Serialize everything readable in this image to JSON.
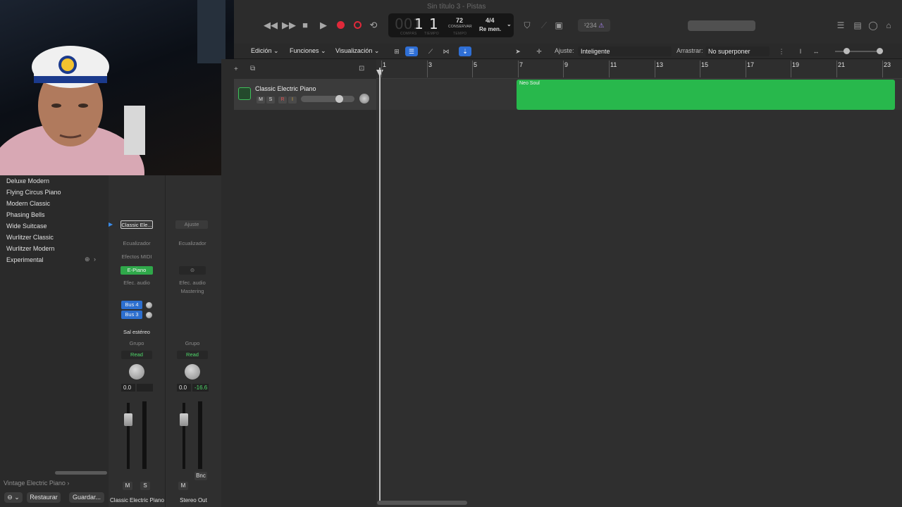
{
  "window": {
    "title": "Sin título 3 - Pistas"
  },
  "transport": {
    "compas": "001",
    "compas_value": "1",
    "tiempo_value": "1",
    "compas_label": "COMPÁS",
    "tiempo_label": "TIEMPO",
    "tempo_value": "72",
    "tempo_mode": "CONSERVAR",
    "tempo_label": "TEMPO",
    "signature": "4/4",
    "key": "Re men.",
    "count_in": "¹234"
  },
  "toolbar": {
    "menus": [
      "Edición",
      "Funciones",
      "Visualización"
    ],
    "ajuste_label": "Ajuste:",
    "ajuste_value": "Inteligente",
    "arrastrar_label": "Arrastrar:",
    "arrastrar_value": "No superponer"
  },
  "library": {
    "items": [
      "Deluxe Modern",
      "Flying Circus Piano",
      "Modern Classic",
      "Phasing Bells",
      "Wide Suitcase",
      "Wurlitzer Classic",
      "Wurlitzer Modern",
      "Experimental"
    ],
    "footer_label": "Vintage Electric Piano",
    "restore_button": "Restaurar",
    "save_button": "Guardar..."
  },
  "strip1": {
    "preset": "Classic Ele...",
    "eq": "Ecualizador",
    "midi": "Efectos MIDI",
    "instrument": "E-Piano",
    "audio_fx": "Efec. audio",
    "send1": "Bus 4",
    "send2": "Bus 3",
    "output": "Sal estéreo",
    "group": "Grupo",
    "automation": "Read",
    "volume": "0.0",
    "mute": "M",
    "solo": "S",
    "name": "Classic Electric Piano"
  },
  "strip2": {
    "setting": "Ajuste",
    "eq": "Ecualizador",
    "audio_fx": "Efec. audio",
    "mastering": "Mastering",
    "group": "Grupo",
    "automation": "Read",
    "volume": "0.0",
    "peak": "-16.6",
    "bounce": "Bnc",
    "mute": "M",
    "name": "Stereo Out"
  },
  "track": {
    "name": "Classic Electric Piano",
    "mute": "M",
    "solo": "S",
    "rec": "R",
    "input": "I"
  },
  "region": {
    "name": "Neo Soul"
  },
  "ruler": {
    "bars": [
      "1",
      "3",
      "5",
      "7",
      "9",
      "11",
      "13",
      "15",
      "17",
      "19",
      "21",
      "23"
    ]
  },
  "colors": {
    "region": "#28b84c",
    "accent": "#2f6fd6",
    "record": "#e0293a"
  }
}
